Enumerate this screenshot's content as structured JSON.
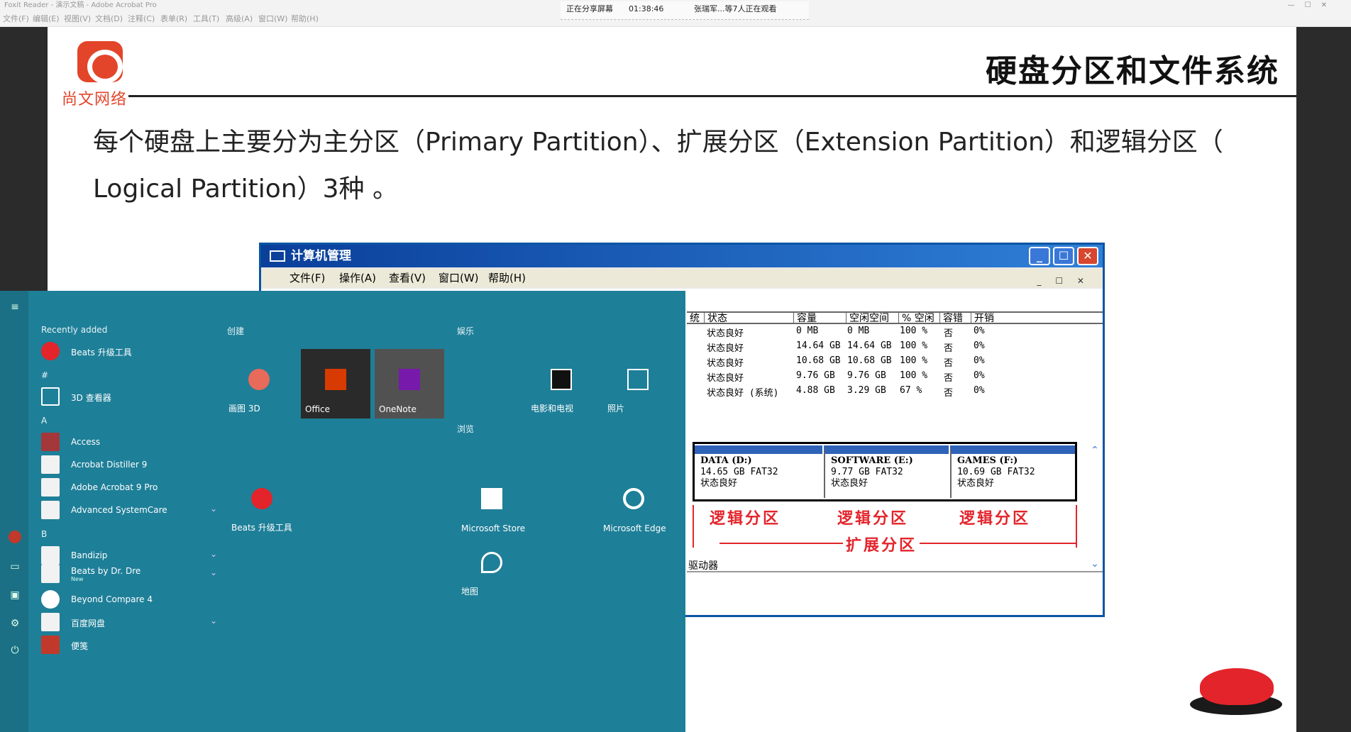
{
  "app": {
    "title": "Foxit Reader - 演示文稿 - Adobe Acrobat Pro",
    "menu": [
      "文件(F)",
      "编辑(E)",
      "视图(V)",
      "文档(D)",
      "注释(C)",
      "表单(R)",
      "工具(T)",
      "高级(A)",
      "窗口(W)",
      "帮助(H)"
    ],
    "share_status": "正在分享屏幕",
    "share_time": "01:38:46",
    "viewers": "张瑞军...等7人正在观看"
  },
  "slide": {
    "logo_text": "尚文网络",
    "title": "硬盘分区和文件系统",
    "body_line1": "每个硬盘上主要分为主分区（Primary  Partition）、扩展分区（Extension  Partition）和逻辑分区（",
    "body_line2": "Logical Partition）3种 。"
  },
  "computer_management": {
    "title": "计算机管理",
    "menu": [
      "文件(F)",
      "操作(A)",
      "查看(V)",
      "窗口(W)",
      "帮助(H)"
    ],
    "columns": [
      "统",
      "状态",
      "容量",
      "空闲空间",
      "% 空闲",
      "容错",
      "开销"
    ],
    "rows": [
      {
        "status": "状态良好",
        "capacity": "0 MB",
        "free": "0 MB",
        "pct": "100 %",
        "fault": "否",
        "overhead": "0%"
      },
      {
        "status": "状态良好",
        "capacity": "14.64 GB",
        "free": "14.64 GB",
        "pct": "100 %",
        "fault": "否",
        "overhead": "0%"
      },
      {
        "status": "状态良好",
        "capacity": "10.68 GB",
        "free": "10.68 GB",
        "pct": "100 %",
        "fault": "否",
        "overhead": "0%"
      },
      {
        "status": "状态良好",
        "capacity": "9.76 GB",
        "free": "9.76 GB",
        "pct": "100 %",
        "fault": "否",
        "overhead": "0%"
      },
      {
        "status": "状态良好 (系统)",
        "capacity": "4.88 GB",
        "free": "3.29 GB",
        "pct": "67 %",
        "fault": "否",
        "overhead": "0%"
      }
    ],
    "partitions": [
      {
        "name": "DATA   (D:)",
        "size": "14.65 GB FAT32",
        "status": "状态良好"
      },
      {
        "name": "SOFTWARE   (E:)",
        "size": "9.77 GB FAT32",
        "status": "状态良好"
      },
      {
        "name": "GAMES   (F:)",
        "size": "10.69 GB FAT32",
        "status": "状态良好"
      }
    ],
    "logical_label": "逻辑分区",
    "extended_label": "扩展分区",
    "drive_label": "驱动器"
  },
  "start_menu": {
    "recent_header": "Recently added",
    "recent_items": [
      {
        "label": "Beats 升级工具"
      }
    ],
    "hash_header": "#",
    "a_header": "A",
    "b_header": "B",
    "items": [
      {
        "label": "3D 查看器"
      },
      {
        "label": "Access"
      },
      {
        "label": "Acrobat Distiller 9"
      },
      {
        "label": "Adobe Acrobat 9 Pro"
      },
      {
        "label": "Advanced SystemCare"
      },
      {
        "label": "Bandizip"
      },
      {
        "label": "Beats by Dr. Dre"
      },
      {
        "label": "Beyond Compare 4"
      },
      {
        "label": "百度网盘"
      },
      {
        "label": "便笺"
      }
    ],
    "beats_sub": "New",
    "groups": {
      "create": "创建",
      "entertain": "娱乐",
      "browse": "浏览"
    },
    "tiles": [
      {
        "label": "画图 3D"
      },
      {
        "label": "Office"
      },
      {
        "label": "OneNote"
      },
      {
        "label": "电影和电视"
      },
      {
        "label": "照片"
      },
      {
        "label": "Beats 升级工具"
      },
      {
        "label": "Microsoft Store"
      },
      {
        "label": "Microsoft Edge"
      },
      {
        "label": "地图"
      }
    ]
  }
}
